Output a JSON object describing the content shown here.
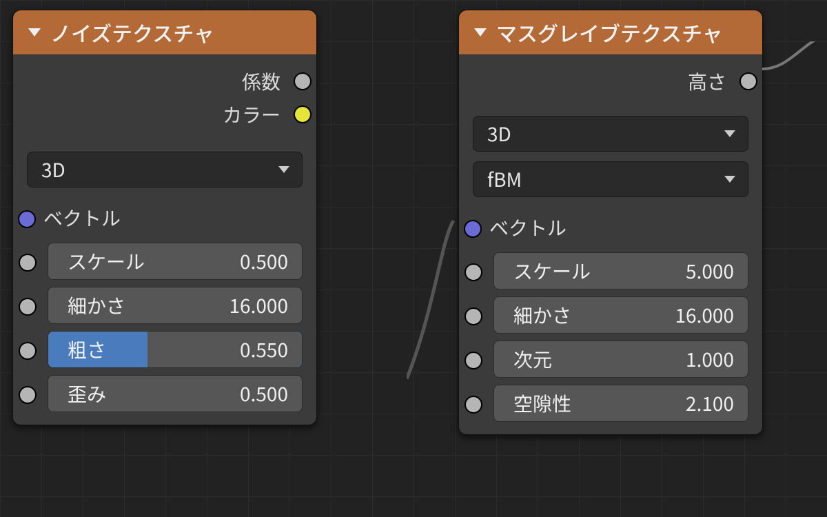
{
  "nodes": {
    "noise": {
      "title": "ノイズテクスチャ",
      "outputs": {
        "fac": {
          "label": "係数",
          "socket": "grey"
        },
        "color": {
          "label": "カラー",
          "socket": "yellow"
        }
      },
      "dropdowns": {
        "dimensions": "3D"
      },
      "inputs": {
        "vector": {
          "label": "ベクトル",
          "socket": "purple"
        },
        "scale": {
          "label": "スケール",
          "value": "0.500",
          "socket": "grey"
        },
        "detail": {
          "label": "細かさ",
          "value": "16.000",
          "socket": "grey"
        },
        "rough": {
          "label": "粗さ",
          "value": "0.550",
          "socket": "grey",
          "selected": true
        },
        "distort": {
          "label": "歪み",
          "value": "0.500",
          "socket": "grey"
        }
      }
    },
    "musgrave": {
      "title": "マスグレイブテクスチャ",
      "outputs": {
        "height": {
          "label": "高さ",
          "socket": "grey"
        }
      },
      "dropdowns": {
        "dimensions": "3D",
        "type": "fBM"
      },
      "inputs": {
        "vector": {
          "label": "ベクトル",
          "socket": "purple"
        },
        "scale": {
          "label": "スケール",
          "value": "5.000",
          "socket": "grey"
        },
        "detail": {
          "label": "細かさ",
          "value": "16.000",
          "socket": "grey"
        },
        "dimension": {
          "label": "次元",
          "value": "1.000",
          "socket": "grey"
        },
        "lacunarity": {
          "label": "空隙性",
          "value": "2.100",
          "socket": "grey"
        }
      }
    }
  }
}
